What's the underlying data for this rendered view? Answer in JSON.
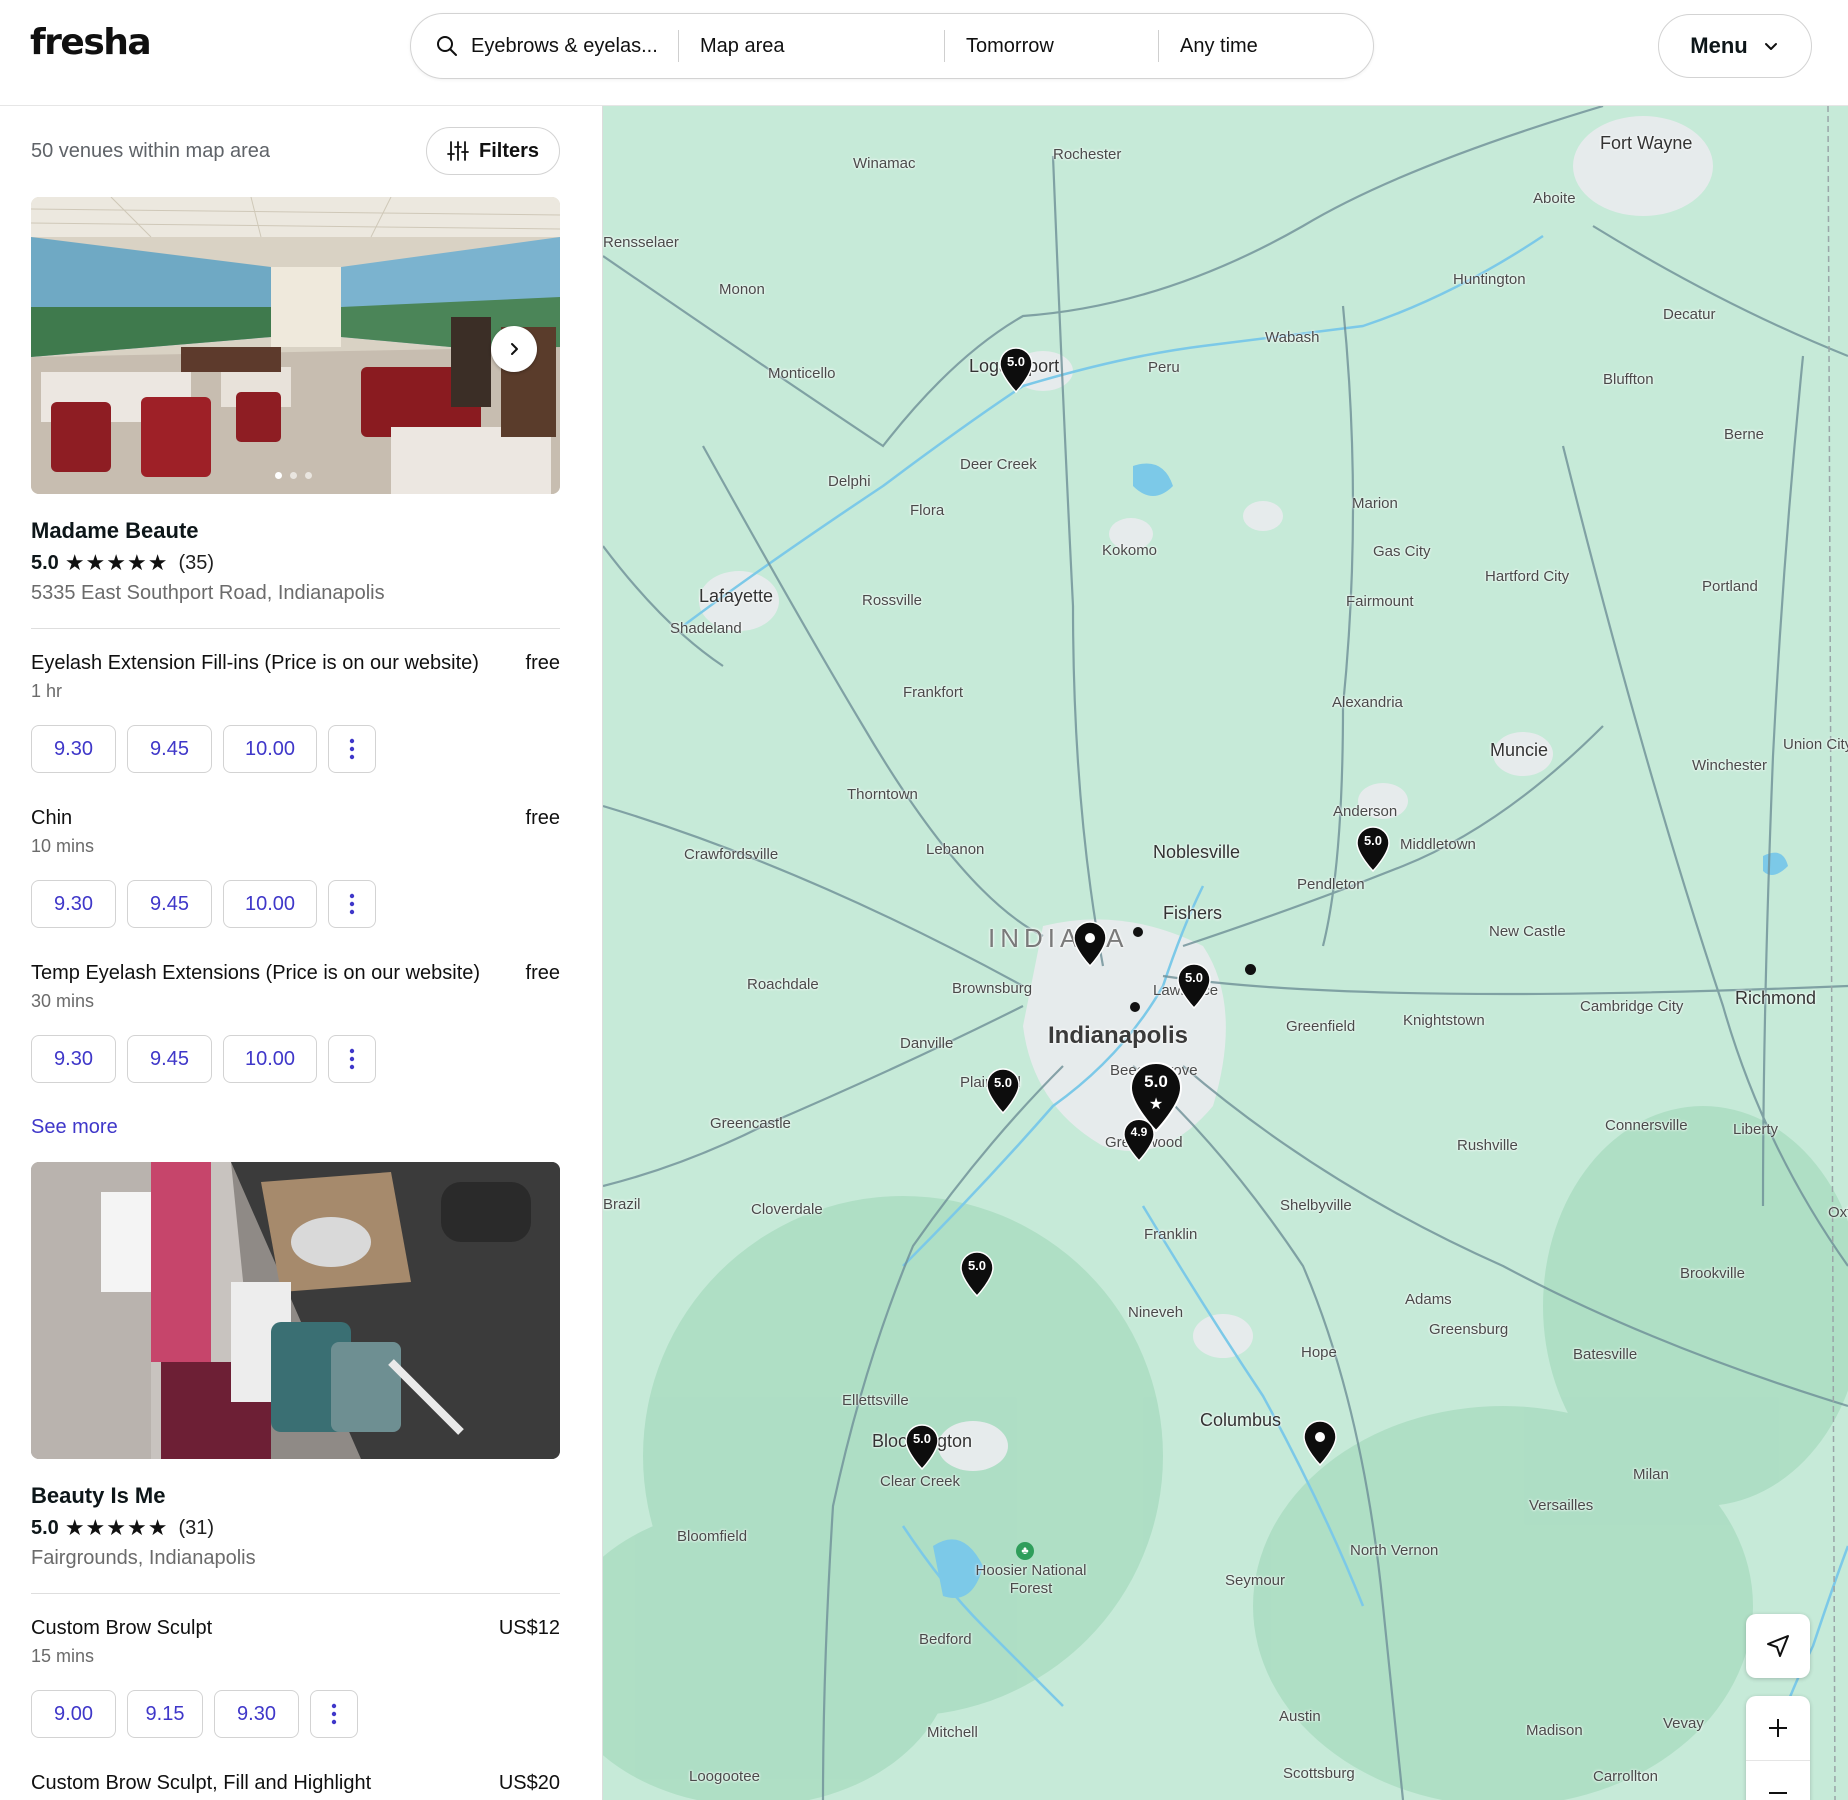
{
  "header": {
    "logo": "fresha",
    "search": {
      "service": "Eyebrows & eyelas...",
      "location": "Map area",
      "date": "Tomorrow",
      "time": "Any time"
    },
    "menu_label": "Menu"
  },
  "results": {
    "count_text": "50 venues within map area",
    "filters_label": "Filters"
  },
  "venues": [
    {
      "name": "Madame Beaute",
      "rating": "5.0",
      "reviews": "(35)",
      "address": "5335 East Southport Road, Indianapolis",
      "services": [
        {
          "name": "Eyelash Extension Fill-ins (Price is on our website)",
          "price": "free",
          "duration": "1 hr",
          "slots": [
            "9.30",
            "9.45",
            "10.00"
          ]
        },
        {
          "name": "Chin",
          "price": "free",
          "duration": "10 mins",
          "slots": [
            "9.30",
            "9.45",
            "10.00"
          ]
        },
        {
          "name": "Temp Eyelash Extensions (Price is on our website)",
          "price": "free",
          "duration": "30 mins",
          "slots": [
            "9.30",
            "9.45",
            "10.00"
          ]
        }
      ],
      "see_more": "See more"
    },
    {
      "name": "Beauty Is Me",
      "rating": "5.0",
      "reviews": "(31)",
      "address": "Fairgrounds, Indianapolis",
      "services": [
        {
          "name": "Custom Brow Sculpt",
          "price": "US$12",
          "duration": "15 mins",
          "slots": [
            "9.00",
            "9.15",
            "9.30"
          ]
        },
        {
          "name": "Custom Brow Sculpt, Fill and Highlight",
          "price": "US$20"
        }
      ]
    }
  ],
  "map": {
    "labels": [
      "Fort Wayne",
      "Rochester",
      "Winamac",
      "Aboite",
      "Huntington",
      "Decatur",
      "Monon",
      "Monticello",
      "Wabash",
      "Logansport",
      "Peru",
      "Bluffton",
      "Berne",
      "Deer Creek",
      "Delphi",
      "Flora",
      "Marion",
      "Kokomo",
      "Gas City",
      "Hartford City",
      "Lafayette",
      "Shadeland",
      "Rossville",
      "Fairmount",
      "Portland",
      "Frankfort",
      "Alexandria",
      "Muncie",
      "Union City",
      "Winchester",
      "Thorntown",
      "Anderson",
      "Middletown",
      "Crawfordsville",
      "Lebanon",
      "Noblesville",
      "Pendleton",
      "Fishers",
      "New Castle",
      "INDIANA",
      "Roachdale",
      "Brownsburg",
      "Lawrence",
      "Cambridge City",
      "Richmond",
      "Greenfield",
      "Knightstown",
      "Danville",
      "Indianapolis",
      "Beech Grove",
      "Plainfield",
      "Greencastle",
      "Greenwood",
      "Rushville",
      "Connersville",
      "Liberty",
      "Cloverdale",
      "Shelbyville",
      "Franklin",
      "Brookville",
      "Adams",
      "Greensburg",
      "Nineveh",
      "Batesville",
      "Hope",
      "Ellettsville",
      "Columbus",
      "Bloomington",
      "Clear Creek",
      "Milan",
      "Versailles",
      "Bloomfield",
      "North Vernon",
      "Hoosier National Forest",
      "Seymour",
      "Bedford",
      "Austin",
      "Madison",
      "Vevay",
      "Mitchell",
      "Scottsburg",
      "Loogootee",
      "Carrollton",
      "Rensselaer",
      "Brazil",
      "Oxford"
    ],
    "pins": [
      "5.0",
      "5.0",
      "5.0",
      "5.0",
      "5.0",
      "4.9",
      "5.0",
      "5.0"
    ],
    "colors": {
      "water": "#7cc9e8",
      "land": "#c6ead8",
      "urban": "#e8ecee",
      "pin": "#0d0d0d"
    }
  },
  "colors": {
    "accent": "#3f37c9",
    "text": "#0d1619",
    "muted": "#6b6b6b"
  }
}
